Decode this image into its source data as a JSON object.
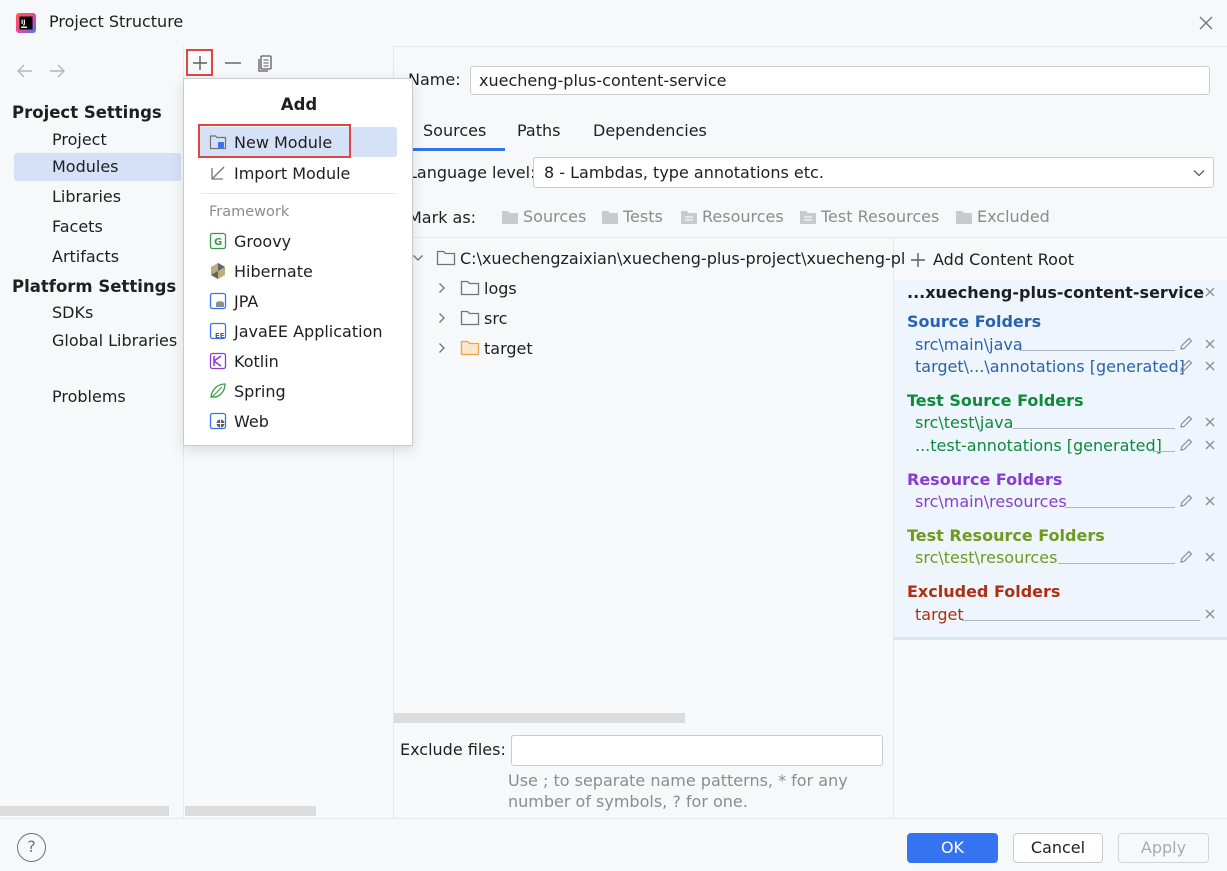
{
  "window": {
    "title": "Project Structure"
  },
  "sidebar": {
    "project_settings_title": "Project Settings",
    "project_items": [
      {
        "label": "Project"
      },
      {
        "label": "Modules",
        "selected": true
      },
      {
        "label": "Libraries"
      },
      {
        "label": "Facets"
      },
      {
        "label": "Artifacts"
      }
    ],
    "platform_settings_title": "Platform Settings",
    "platform_items": [
      {
        "label": "SDKs"
      },
      {
        "label": "Global Libraries"
      }
    ],
    "problems_label": "Problems"
  },
  "popup": {
    "title": "Add",
    "items": [
      {
        "label": "New Module",
        "icon": "new-module-icon",
        "selected": true
      },
      {
        "label": "Import Module",
        "icon": "import-module-icon"
      }
    ],
    "framework_label": "Framework",
    "frameworks": [
      {
        "label": "Groovy",
        "icon": "groovy-icon"
      },
      {
        "label": "Hibernate",
        "icon": "hibernate-icon"
      },
      {
        "label": "JPA",
        "icon": "jpa-icon"
      },
      {
        "label": "JavaEE Application",
        "icon": "javaee-icon"
      },
      {
        "label": "Kotlin",
        "icon": "kotlin-icon"
      },
      {
        "label": "Spring",
        "icon": "spring-icon"
      },
      {
        "label": "Web",
        "icon": "web-icon"
      }
    ]
  },
  "module": {
    "name_label": "Name:",
    "name_value": "xuecheng-plus-content-service",
    "tabs": [
      {
        "label": "Sources",
        "active": true
      },
      {
        "label": "Paths"
      },
      {
        "label": "Dependencies"
      }
    ],
    "language_level_label": "Language level:",
    "language_level_value": "8 - Lambdas, type annotations etc.",
    "mark_as_label": "Mark as:",
    "mark_as": [
      {
        "label": "Sources"
      },
      {
        "label": "Tests"
      },
      {
        "label": "Resources"
      },
      {
        "label": "Test Resources"
      },
      {
        "label": "Excluded"
      }
    ],
    "tree": {
      "root": "C:\\xuechengzaixian\\xuecheng-plus-project\\xuecheng-pl",
      "children": [
        {
          "label": "logs",
          "color": "#6f737a"
        },
        {
          "label": "src",
          "color": "#6f737a"
        },
        {
          "label": "target",
          "color": "#e8a24a"
        }
      ]
    },
    "exclude_files_label": "Exclude files:",
    "exclude_files_value": "",
    "exclude_hint_1": "Use ; to separate name patterns, * for any",
    "exclude_hint_2": "number of symbols, ? for one."
  },
  "content_root": {
    "add_label": "Add Content Root",
    "title": "...xuecheng-plus-content-service",
    "groups": [
      {
        "title": "Source Folders",
        "color": "#2a63ad",
        "paths": [
          "src\\main\\java",
          "target\\...\\annotations [generated]"
        ]
      },
      {
        "title": "Test Source Folders",
        "color": "#0f8a3b",
        "paths": [
          "src\\test\\java",
          "...test-annotations [generated]"
        ]
      },
      {
        "title": "Resource Folders",
        "color": "#8a3ccf",
        "paths": [
          "src\\main\\resources"
        ]
      },
      {
        "title": "Test Resource Folders",
        "color": "#6e9a1e",
        "paths": [
          "src\\test\\resources"
        ]
      },
      {
        "title": "Excluded Folders",
        "color": "#b02f12",
        "paths": [
          "target"
        ]
      }
    ]
  },
  "footer": {
    "help_label": "?",
    "ok_label": "OK",
    "cancel_label": "Cancel",
    "apply_label": "Apply"
  }
}
